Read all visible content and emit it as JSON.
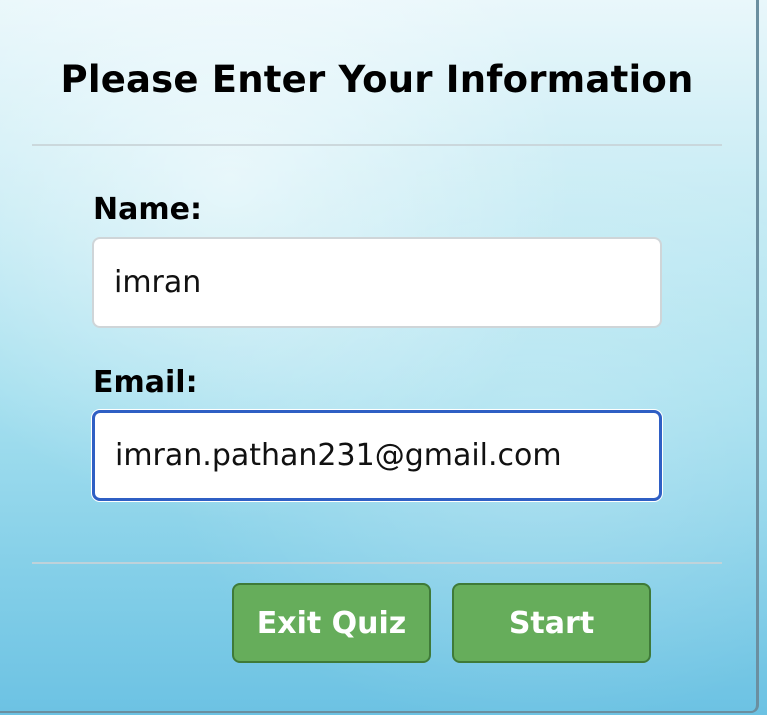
{
  "form": {
    "title": "Please Enter Your Information",
    "name_label": "Name:",
    "name_value": "imran",
    "email_label": "Email:",
    "email_value": "imran.pathan231@gmail.com"
  },
  "actions": {
    "exit_label": "Exit Quiz",
    "start_label": "Start"
  },
  "colors": {
    "button_green": "#66ad5b",
    "focus_border": "#2f5fc4"
  }
}
